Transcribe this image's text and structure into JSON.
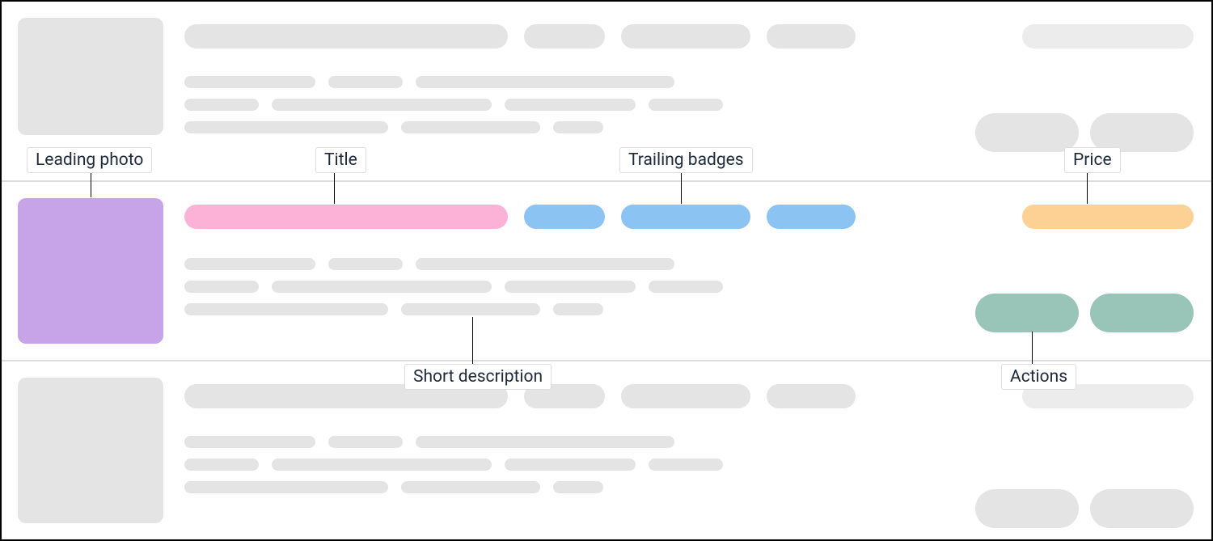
{
  "annotations": {
    "leading_photo": "Leading photo",
    "title": "Title",
    "trailing_badges": "Trailing badges",
    "price": "Price",
    "short_description": "Short description",
    "actions": "Actions"
  },
  "colors": {
    "placeholder": "#e4e4e4",
    "leading_photo": "#c7a4e8",
    "title": "#fbb2d6",
    "trailing_badges": "#8bc4f2",
    "price": "#fcd193",
    "actions": "#98c5b8"
  }
}
